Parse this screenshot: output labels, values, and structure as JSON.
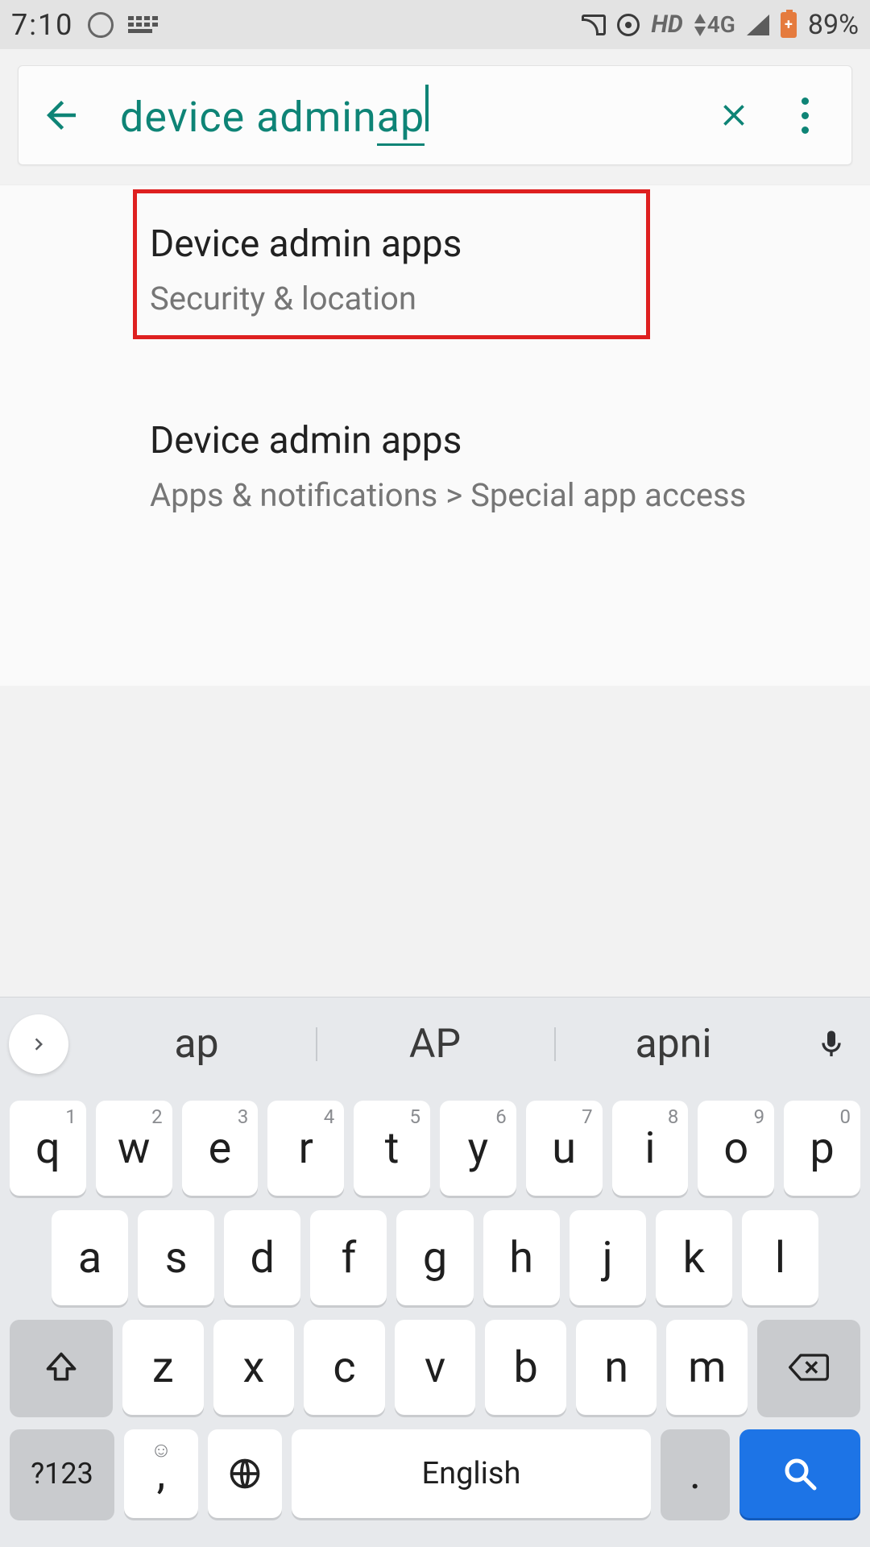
{
  "status": {
    "time": "7:10",
    "network_label": "HD",
    "data_label": "4G",
    "battery_pct": "89%"
  },
  "search": {
    "prefix": "device admin ",
    "suffix": "ap"
  },
  "results": [
    {
      "title": "Device admin apps",
      "subtitle": "Security & location"
    },
    {
      "title": "Device admin apps",
      "subtitle": "Apps & notifications > Special app access"
    }
  ],
  "keyboard": {
    "suggestions": [
      "ap",
      "AP",
      "apni"
    ],
    "row1": [
      {
        "k": "q",
        "h": "1"
      },
      {
        "k": "w",
        "h": "2"
      },
      {
        "k": "e",
        "h": "3"
      },
      {
        "k": "r",
        "h": "4"
      },
      {
        "k": "t",
        "h": "5"
      },
      {
        "k": "y",
        "h": "6"
      },
      {
        "k": "u",
        "h": "7"
      },
      {
        "k": "i",
        "h": "8"
      },
      {
        "k": "o",
        "h": "9"
      },
      {
        "k": "p",
        "h": "0"
      }
    ],
    "row2": [
      "a",
      "s",
      "d",
      "f",
      "g",
      "h",
      "j",
      "k",
      "l"
    ],
    "row3": [
      "z",
      "x",
      "c",
      "v",
      "b",
      "n",
      "m"
    ],
    "symbols_label": "?123",
    "space_label": "English",
    "comma": ",",
    "dot": "."
  }
}
